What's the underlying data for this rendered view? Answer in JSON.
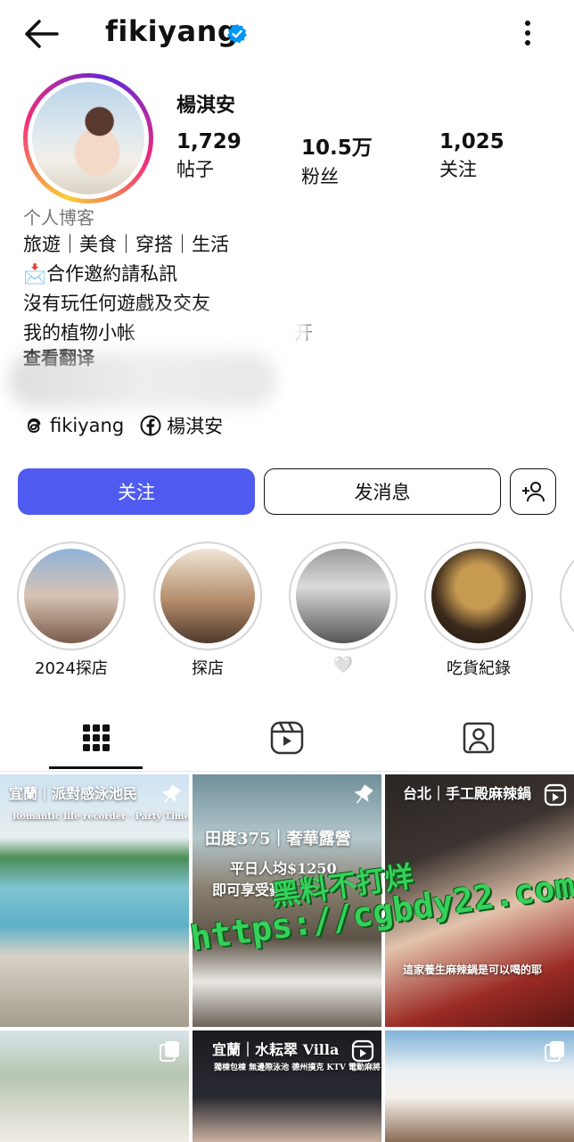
{
  "header": {
    "username": "fikiyang"
  },
  "profile": {
    "full_name": "楊淇安",
    "stats": [
      {
        "value": "1,729",
        "label": "帖子"
      },
      {
        "value": "10.5万",
        "label": "粉丝"
      },
      {
        "value": "1,025",
        "label": "关注"
      }
    ],
    "category": "个人博客",
    "bio_lines": [
      "旅遊｜美食｜穿搭｜生活",
      "📩合作邀約請私訊",
      "沒有玩任何遊戲及交友",
      "我的植物小帐",
      "开"
    ],
    "translate_label": "查看翻译",
    "links": [
      {
        "icon": "threads-icon",
        "text": "fikiyang"
      },
      {
        "icon": "facebook-icon",
        "text": "楊淇安"
      }
    ]
  },
  "actions": {
    "follow_label": "关注",
    "message_label": "发消息"
  },
  "highlights": [
    {
      "label": "2024探店"
    },
    {
      "label": "探店"
    },
    {
      "label": "🤍"
    },
    {
      "label": "吃貨紀錄"
    }
  ],
  "grid_posts": [
    {
      "overlay": "宜蘭｜派對感泳池民",
      "sub": "Romantic life recorder · Party Time",
      "icon": "pin-icon"
    },
    {
      "overlay": "田度375｜奢華露營",
      "sub": "平日人均$1250",
      "sub2": "即可享受豪華",
      "icon": "pin-icon"
    },
    {
      "overlay": "台北｜手工殿麻辣鍋",
      "sub": "這家養生麻辣鍋是可以喝的耶",
      "icon": "reel-icon"
    },
    {
      "overlay": "",
      "icon": "carousel-icon"
    },
    {
      "overlay": "宜蘭｜水耘翠 Villa",
      "sub": "獨棟包棟 無邊際泳池 德州撲克 KTV 電動麻將",
      "icon": "reel-icon"
    },
    {
      "overlay": "",
      "icon": "carousel-icon"
    }
  ],
  "watermark": {
    "line1": "黑料不打烊",
    "line2": "https://cgbdy22.com"
  },
  "colors": {
    "follow_button": "#4f5bf0",
    "verified": "#0095f6"
  }
}
